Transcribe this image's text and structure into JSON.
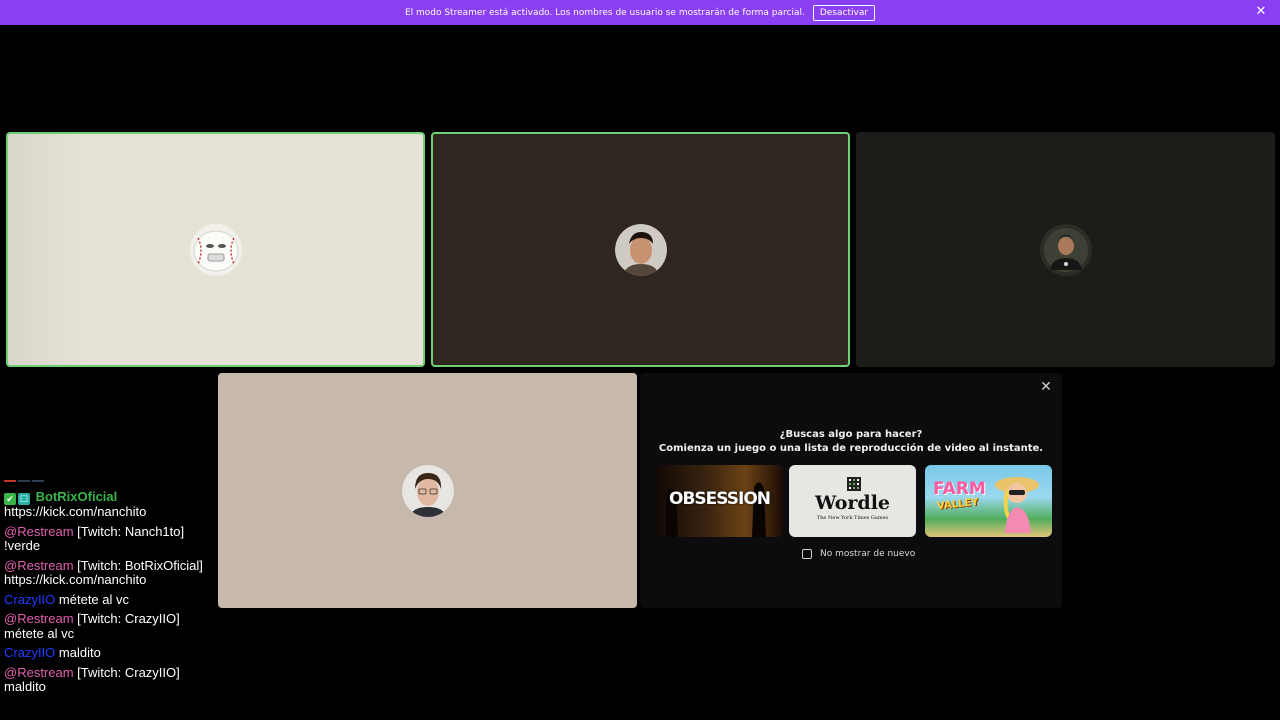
{
  "banner": {
    "message": "El modo Streamer está activado. Los nombres de usuario se mostrarán de forma parcial.",
    "button_label": "Desactivar",
    "close_glyph": "✕"
  },
  "activity": {
    "close_glyph": "✕",
    "heading": "¿Buscas algo para hacer?",
    "subheading": "Comienza un juego o una lista de reproducción de video al instante.",
    "cards": [
      {
        "title": "OBSESSION"
      },
      {
        "title": "Wordle",
        "subtitle": "The New York Times Games"
      },
      {
        "title": "FARM",
        "subtitle": "VALLEY"
      }
    ],
    "dont_show_again": "No mostrar de nuevo"
  },
  "chat": {
    "messages": [
      {
        "user": "BotRixOficial",
        "text": "https://kick.com/nanchito"
      },
      {
        "user": "@Restream",
        "text": "[Twitch: Nanch1to] !verde"
      },
      {
        "user": "@Restream",
        "text": "[Twitch: BotRixOficial] https://kick.com/nanchito"
      },
      {
        "user": "CrazyIIO",
        "text": "métete al vc"
      },
      {
        "user": "@Restream",
        "text": "[Twitch: CrazyIIO] métete al vc"
      },
      {
        "user": "CrazyIIO",
        "text": "maldito"
      },
      {
        "user": "@Restream",
        "text": "[Twitch: CrazyIIO] maldito"
      }
    ]
  },
  "colors": {
    "banner": "#8a3ff2",
    "speaking_ring": "#6fcf74",
    "bot_user": "#39b54a",
    "restream_user": "#e05fae",
    "crazy_user": "#1f3cff"
  }
}
